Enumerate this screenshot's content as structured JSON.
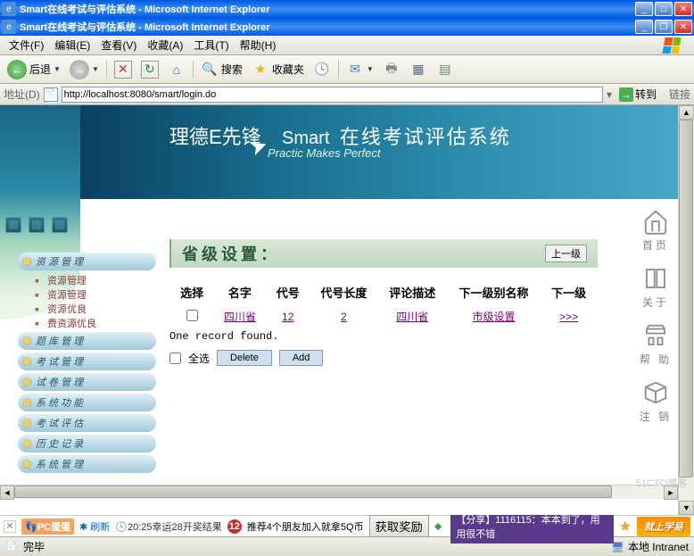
{
  "window1": {
    "title": "Smart在线考试与评估系统 - Microsoft Internet Explorer"
  },
  "window2": {
    "title": "Smart在线考试与评估系统 - Microsoft Internet Explorer"
  },
  "menubar": {
    "file": "文件(F)",
    "edit": "编辑(E)",
    "view": "查看(V)",
    "fav": "收藏(A)",
    "tools": "工具(T)",
    "help": "帮助(H)"
  },
  "toolbar": {
    "back": "后退",
    "search": "搜索",
    "fav": "收藏夹"
  },
  "addr": {
    "label": "地址(D)",
    "url": "http://localhost:8080/smart/login.do",
    "go": "转到",
    "links": "链接"
  },
  "banner": {
    "cn1": "理德E先锋",
    "en1": "Smart",
    "cn2": "在线考试评估系统",
    "sub": "Practic Makes Perfect"
  },
  "sidebar": {
    "group1": "资 源 管 理",
    "sub1": [
      "资源管理",
      "资源管理",
      "资源优良",
      "费资源优良"
    ],
    "items": [
      "题 库 管 理",
      "考 试 管 理",
      "试 卷 管 理",
      "系 统 功 能",
      "考 试 评 估",
      "历 史 记 录",
      "系 统 管 理"
    ]
  },
  "panel": {
    "title": "省级设置：",
    "up": "上一级",
    "headers": [
      "选择",
      "名字",
      "代号",
      "代号长度",
      "评论描述",
      "下一级别名称",
      "下一级"
    ],
    "row": {
      "name": "四川省",
      "code": "12",
      "codelen": "2",
      "desc": "四川省",
      "nextname": "市级设置",
      "next": ">>>"
    },
    "record": "One record found.",
    "selectall": "全选",
    "delete": "Delete",
    "add": "Add"
  },
  "rnav": {
    "home": "首页",
    "about": "关于",
    "help": "帮 助",
    "logout": "注 销"
  },
  "bottombar": {
    "pc": "PC蛋蛋",
    "refresh": "刷新",
    "lottery": "20:25幸运28开奖结果",
    "num": "12",
    "reco": "推荐4个朋友加入就拿5Q币",
    "award": "获取奖励",
    "share": "【分享】1116115：本本到了，用用很不错",
    "xue": "就上学易"
  },
  "status": {
    "done": "完毕",
    "intranet": "本地 Intranet"
  },
  "watermark": "51CTO博客"
}
